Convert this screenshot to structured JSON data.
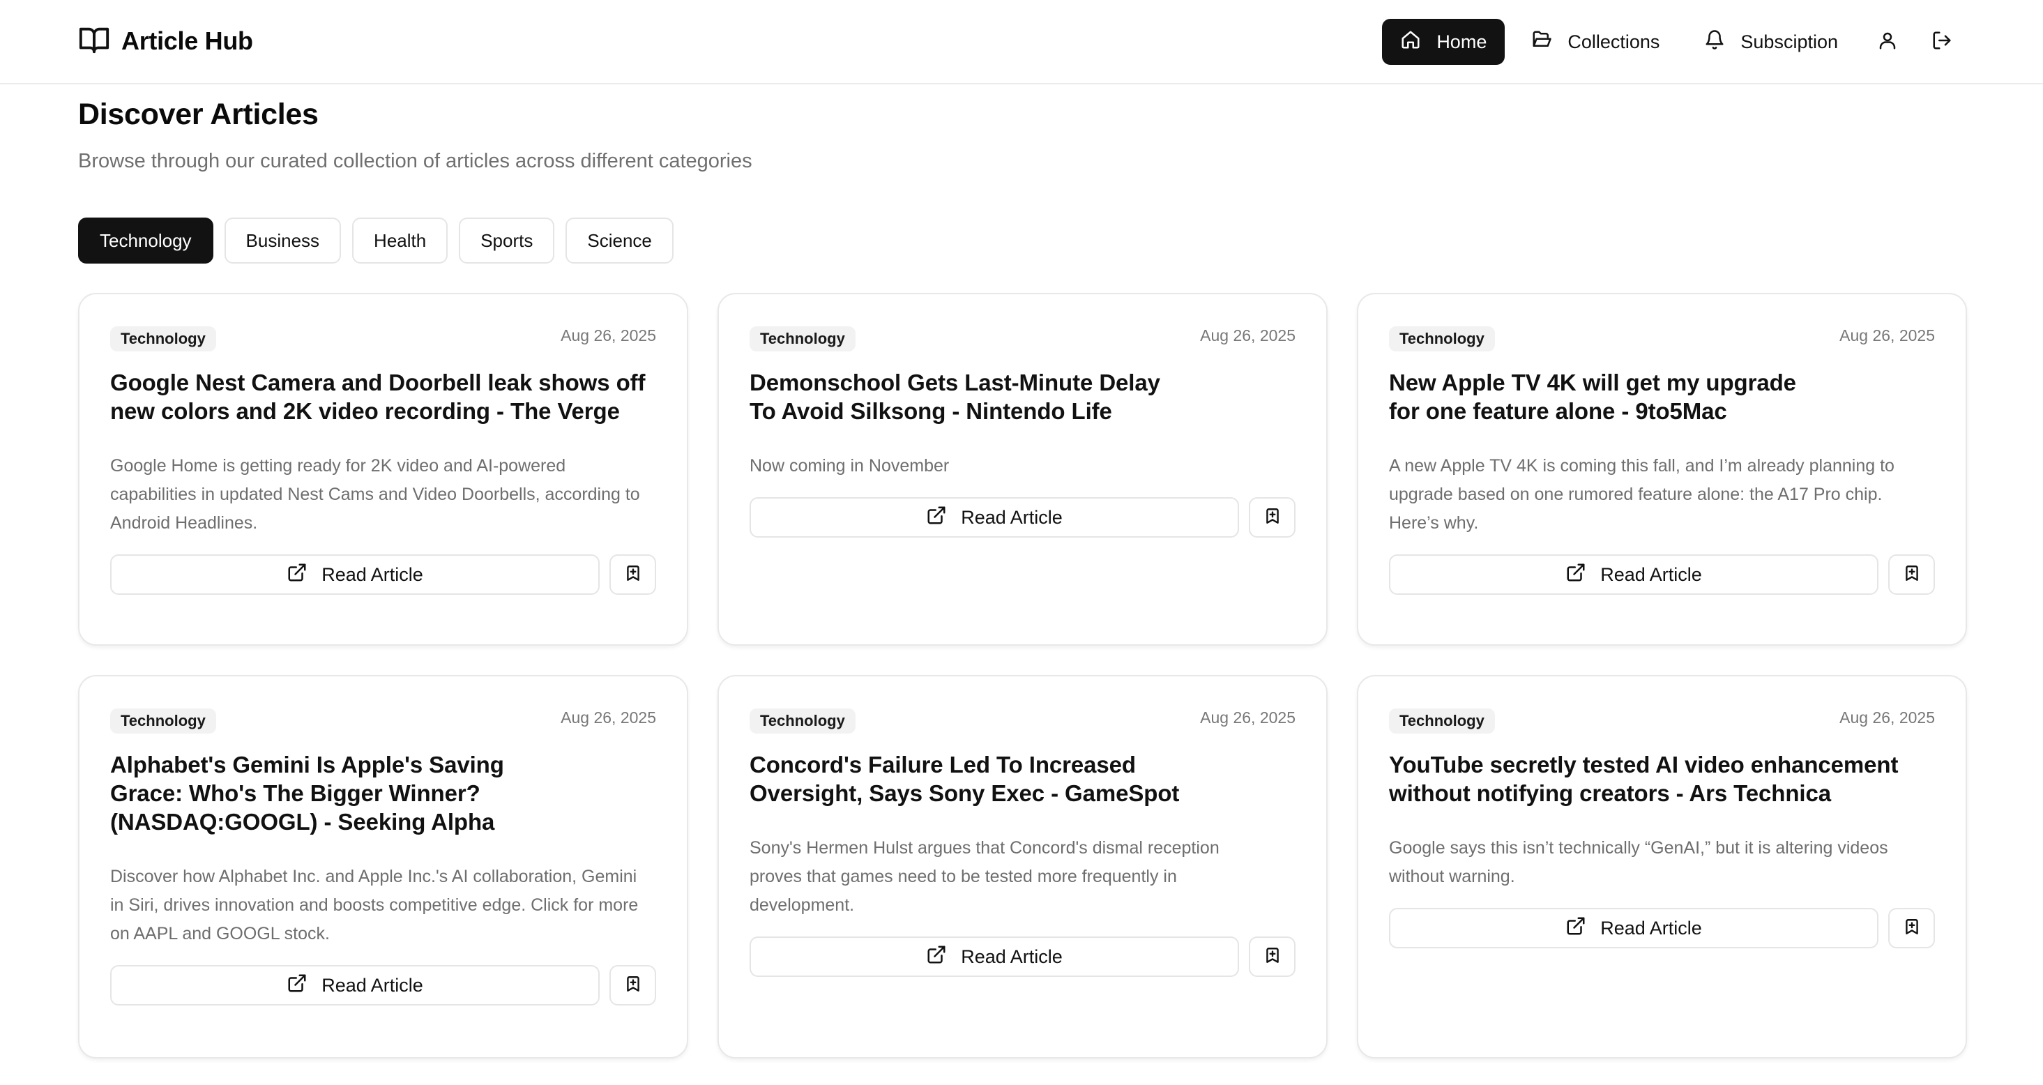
{
  "app": {
    "name": "Article Hub",
    "logo_icon": "book-open-icon"
  },
  "nav": {
    "items": [
      {
        "label": "Home",
        "icon": "home-icon",
        "active": true
      },
      {
        "label": "Collections",
        "icon": "folder-open-icon",
        "active": false
      },
      {
        "label": "Subsciption",
        "icon": "bell-icon",
        "active": false
      }
    ],
    "profile_icon": "user-icon",
    "logout_icon": "logout-icon"
  },
  "page": {
    "title": "Discover Articles",
    "subtitle": "Browse through our curated collection of articles across different categories"
  },
  "categories": [
    "Technology",
    "Business",
    "Health",
    "Sports",
    "Science"
  ],
  "active_category": "Technology",
  "articles": [
    {
      "category": "Technology",
      "date": "Aug 26, 2025",
      "title": "Google Nest Camera and Doorbell leak shows off new colors and 2K video recording - The Verge",
      "description": "Google Home is getting ready for 2K video and AI-powered capabilities in updated Nest Cams and Video Doorbells, according to Android Headlines."
    },
    {
      "category": "Technology",
      "date": "Aug 26, 2025",
      "title": "Demonschool Gets Last-Minute Delay To Avoid Silksong - Nintendo Life",
      "description": "Now coming in November"
    },
    {
      "category": "Technology",
      "date": "Aug 26, 2025",
      "title": "New Apple TV 4K will get my upgrade for one feature alone - 9to5Mac",
      "description": "A new Apple TV 4K is coming this fall, and I’m already planning to upgrade based on one rumored feature alone: the A17 Pro chip. Here’s why."
    },
    {
      "category": "Technology",
      "date": "Aug 26, 2025",
      "title": "Alphabet's Gemini Is Apple's Saving Grace: Who's The Bigger Winner? (NASDAQ:GOOGL) - Seeking Alpha",
      "description": "Discover how Alphabet Inc. and Apple Inc.'s AI collaboration, Gemini in Siri, drives innovation and boosts competitive edge. Click for more on AAPL and GOOGL stock."
    },
    {
      "category": "Technology",
      "date": "Aug 26, 2025",
      "title": "Concord's Failure Led To Increased Oversight, Says Sony Exec - GameSpot",
      "description": "Sony's Hermen Hulst argues that Concord's dismal reception proves that games need to be tested more frequently in development."
    },
    {
      "category": "Technology",
      "date": "Aug 26, 2025",
      "title": "YouTube secretly tested AI video enhancement without notifying creators - Ars Technica",
      "description": "Google says this isn’t technically “GenAI,” but it is altering videos without warning."
    }
  ],
  "card_actions": {
    "read_label": "Read Article",
    "read_icon": "external-link-icon",
    "bookmark_icon": "bookmark-plus-icon"
  }
}
